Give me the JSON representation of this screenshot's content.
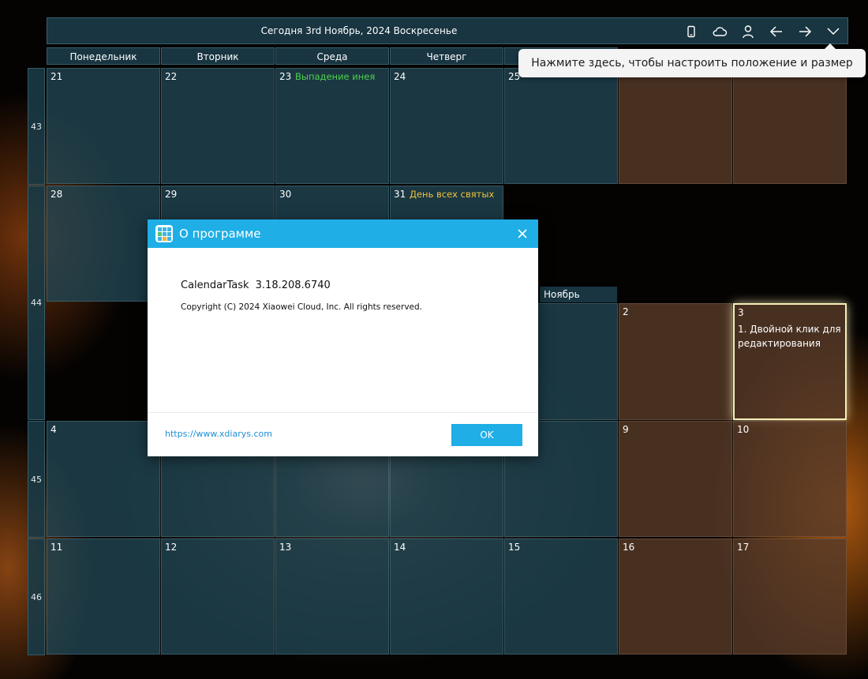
{
  "header": {
    "title": "Сегодня 3rd Ноябрь, 2024 Воскресенье",
    "buttons": [
      "phone-icon",
      "cloud-icon",
      "user-icon",
      "arrow-left-icon",
      "arrow-right-icon",
      "chevron-down-icon"
    ]
  },
  "tooltip": "Нажмите здесь, чтобы настроить положение и размер",
  "weekdays": [
    "Понедельник",
    "Вторник",
    "Среда",
    "Четверг"
  ],
  "weeks": [
    "43",
    "44",
    "45",
    "46"
  ],
  "days": {
    "d21": "21",
    "d22": "22",
    "d23": "23",
    "d24": "24",
    "d25": "25",
    "d28": "28",
    "d29": "29",
    "d30": "30",
    "d31": "31",
    "d2": "2",
    "d3": "3",
    "d4": "4",
    "d9": "9",
    "d10": "10",
    "d11": "11",
    "d12": "12",
    "d13": "13",
    "d14": "14",
    "d15": "15",
    "d16": "16",
    "d17": "17"
  },
  "holidays": {
    "h23": "Выпадение инея",
    "h31": "День всех святых"
  },
  "holiday_colors": {
    "solar_term": "#4fd24f",
    "festival": "#f0c23a"
  },
  "month_label": "Ноябрь",
  "today_note": "1. Двойной клик для редактирования",
  "dialog": {
    "title": "О программе",
    "app_name": "CalendarTask",
    "version": "3.18.208.6740",
    "copyright": "Copyright (C) 2024 Xiaowei Cloud, Inc. All rights reserved.",
    "link": "https://www.xdiarys.com",
    "ok": "OK"
  },
  "colors": {
    "accent": "#1faee6",
    "today_border": "#f4eeb8"
  }
}
